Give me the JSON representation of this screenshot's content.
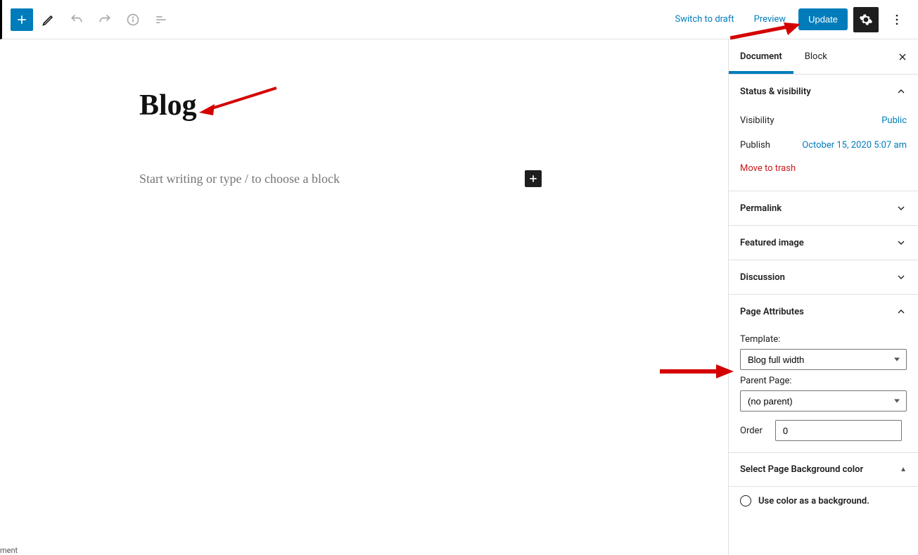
{
  "toolbar": {
    "switch_to_draft": "Switch to draft",
    "preview": "Preview",
    "update": "Update"
  },
  "editor": {
    "title": "Blog",
    "placeholder": "Start writing or type / to choose a block"
  },
  "sidebar": {
    "tabs": {
      "document": "Document",
      "block": "Block"
    },
    "status": {
      "heading": "Status & visibility",
      "visibility_label": "Visibility",
      "visibility_value": "Public",
      "publish_label": "Publish",
      "publish_value": "October 15, 2020 5:07 am",
      "trash": "Move to trash"
    },
    "panels": {
      "permalink": "Permalink",
      "featured_image": "Featured image",
      "discussion": "Discussion",
      "page_attributes": "Page Attributes",
      "bg_color": "Select Page Background color"
    },
    "attrs": {
      "template_label": "Template:",
      "template_value": "Blog full width",
      "parent_label": "Parent Page:",
      "parent_value": "(no parent)",
      "order_label": "Order",
      "order_value": "0"
    },
    "bg": {
      "use_color": "Use color as a background."
    }
  },
  "footer_fragment": "ment"
}
